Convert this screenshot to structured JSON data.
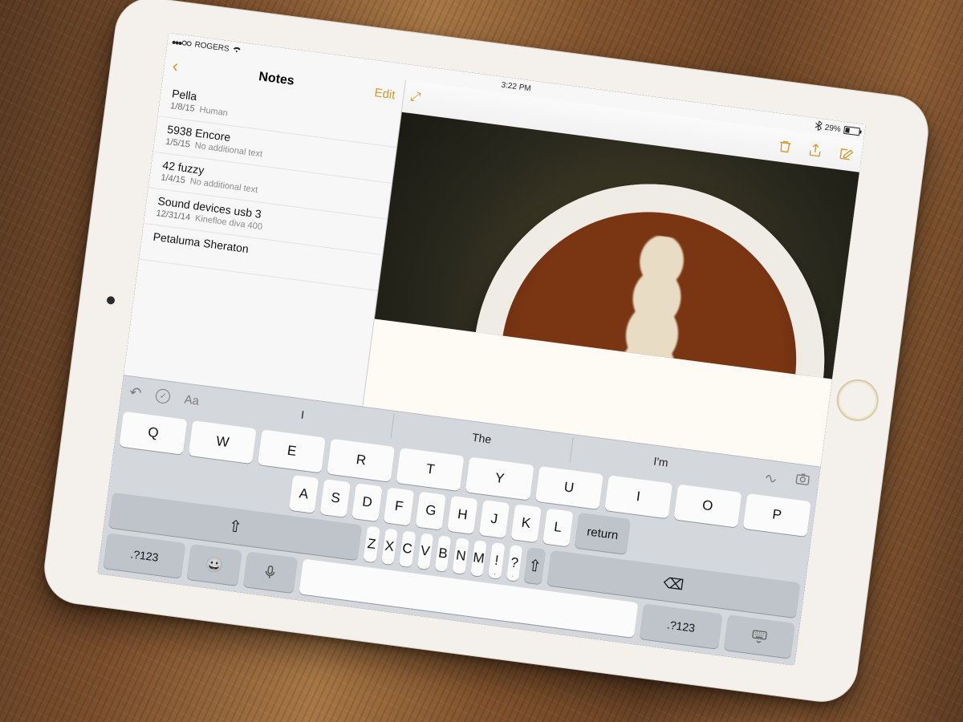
{
  "statusbar": {
    "carrier": "ROGERS",
    "time": "3:22 PM",
    "battery_pct": "29%"
  },
  "sidebar": {
    "back_glyph": "‹",
    "title": "Notes",
    "edit": "Edit",
    "items": [
      {
        "title": "Pella",
        "date": "1/8/15",
        "preview": "Human"
      },
      {
        "title": "5938 Encore",
        "date": "1/5/15",
        "preview": "No additional text"
      },
      {
        "title": "42 fuzzy",
        "date": "1/4/15",
        "preview": "No additional text"
      },
      {
        "title": "Sound devices usb 3",
        "date": "12/31/14",
        "preview": "Kinefloe diva 400"
      },
      {
        "title": "Petaluma Sheraton",
        "date": "",
        "preview": ""
      }
    ]
  },
  "content": {
    "expand_glyph": "⤢"
  },
  "keyboard": {
    "toolbar": {
      "undo_glyph": "↶",
      "check_glyph": "✓",
      "font_glyph": "Aa"
    },
    "suggestions": [
      "I",
      "The",
      "I'm"
    ],
    "row1": [
      "Q",
      "W",
      "E",
      "R",
      "T",
      "Y",
      "U",
      "I",
      "O",
      "P"
    ],
    "row2": [
      "A",
      "S",
      "D",
      "F",
      "G",
      "H",
      "J",
      "K",
      "L"
    ],
    "row3": [
      "Z",
      "X",
      "C",
      "V",
      "B",
      "N",
      "M",
      "!",
      "?"
    ],
    "row3_sub": [
      "",
      "",
      "",
      "",
      "",
      "",
      "",
      ",",
      "."
    ],
    "shift_glyph": "⇧",
    "backspace_glyph": "⌫",
    "sym_label": ".?123",
    "emoji_glyph": "😀",
    "mic_glyph": "🎤",
    "return_label": "return",
    "hidekb_glyph": "⌨"
  }
}
